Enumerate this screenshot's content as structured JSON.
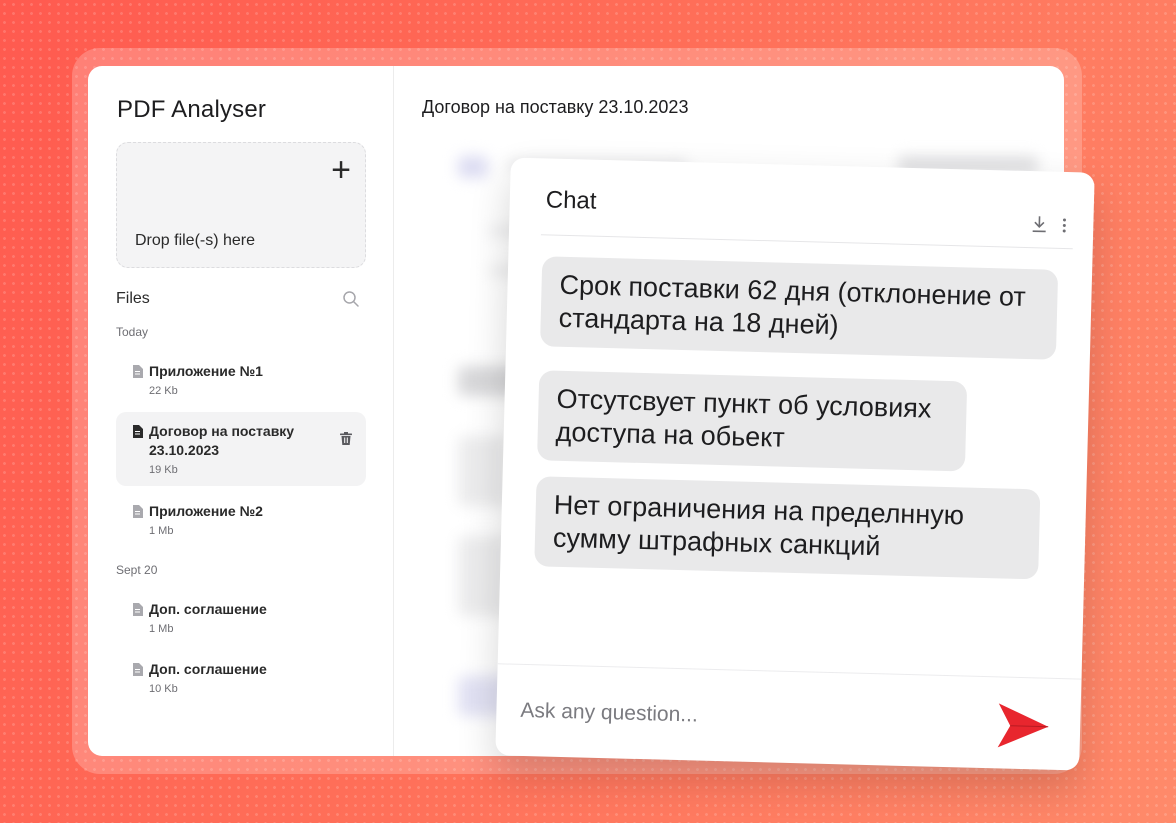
{
  "app": {
    "title": "PDF Analyser"
  },
  "dropzone": {
    "label": "Drop file(-s) here",
    "icon": "plus-icon"
  },
  "files": {
    "label": "Files",
    "search_icon": "search-icon",
    "groups": [
      {
        "label": "Today",
        "items": [
          {
            "name": "Приложение №1",
            "size": "22 Kb"
          },
          {
            "name": "Договор на поставку 23.10.2023",
            "size": "19 Kb",
            "active": true
          },
          {
            "name": "Приложение №2",
            "size": "1 Mb"
          }
        ]
      },
      {
        "label": "Sept 20",
        "items": [
          {
            "name": "Доп. соглашение",
            "size": "1 Mb"
          },
          {
            "name": "Доп. соглашение",
            "size": "10 Kb"
          }
        ]
      }
    ]
  },
  "document": {
    "title": "Договор на поставку 23.10.2023"
  },
  "chat": {
    "title": "Chat",
    "messages": [
      "Срок поставки 62 дня (отклонение от стандарта на 18 дней)",
      "Отсутсвует пункт об условиях доступа на обьект",
      "Нет ограничения на пределнную сумму штрафных санкций"
    ],
    "input": {
      "placeholder": "Ask any question...",
      "value": ""
    }
  },
  "colors": {
    "accent": "#e8262e",
    "background": "#ff6554",
    "bubble": "#e9e9ea"
  }
}
